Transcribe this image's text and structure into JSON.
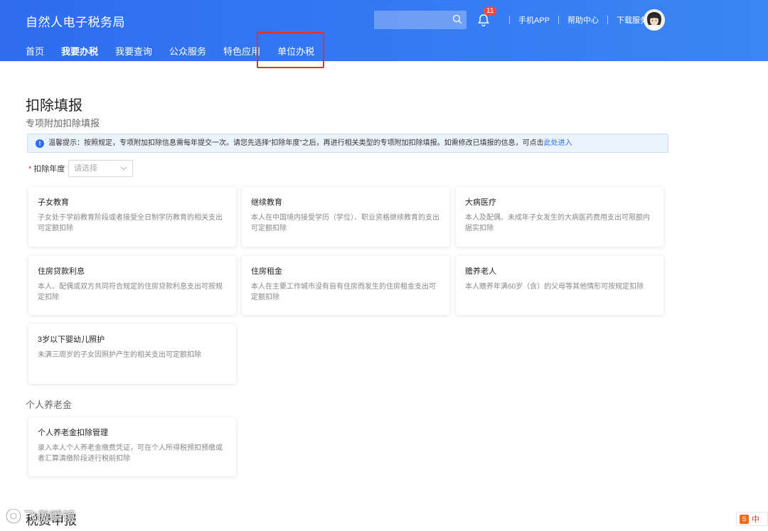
{
  "header": {
    "app_title": "自然人电子税务局",
    "search": {
      "value": "",
      "placeholder": ""
    },
    "notification_count": "11",
    "links": [
      "手机APP",
      "帮助中心",
      "下载服务"
    ]
  },
  "nav": {
    "items": [
      {
        "label": "首页",
        "active": false
      },
      {
        "label": "我要办税",
        "active": true
      },
      {
        "label": "我要查询",
        "active": false
      },
      {
        "label": "公众服务",
        "active": false
      },
      {
        "label": "特色应用",
        "active": false
      },
      {
        "label": "单位办税",
        "active": false
      }
    ]
  },
  "main": {
    "page_title": "扣除填报",
    "section_title": "专项附加扣除填报",
    "notice": {
      "text": "温馨提示：按照规定，专项附加扣除信息需每年提交一次。请您先选择“扣除年度”之后，再进行相关类型的专项附加扣除填报。如需修改已填报的信息，可点击",
      "link": "此处进入"
    },
    "year_field": {
      "label": "扣除年度",
      "placeholder": "请选择"
    },
    "cards": [
      {
        "title": "子女教育",
        "desc": "子女处于学前教育阶段或者接受全日制学历教育的相关支出可定额扣除"
      },
      {
        "title": "继续教育",
        "desc": "本人在中国境内接受学历（学位）、职业资格继续教育的支出可定额扣除"
      },
      {
        "title": "大病医疗",
        "desc": "本人及配偶、未成年子女发生的大病医药费用支出可限额内据实扣除"
      },
      {
        "title": "住房贷款利息",
        "desc": "本人、配偶或双方共同符合规定的住房贷款利息支出可按规定扣除"
      },
      {
        "title": "住房租金",
        "desc": "本人在主要工作城市没有自有住房而发生的住房租金支出可定额扣除"
      },
      {
        "title": "赡养老人",
        "desc": "本人赡养年满60岁（含）的父母等其他情形可按规定扣除"
      },
      {
        "title": "3岁以下婴幼儿照护",
        "desc": "未满三周岁的子女因照护产生的相关支出可定额扣除"
      }
    ],
    "pension": {
      "section_title": "个人养老金",
      "card": {
        "title": "个人养老金扣除管理",
        "desc": "录入本人个人养老金缴费凭证，可在个人所得税预扣预缴或者汇算清缴阶段进行税前扣除"
      }
    },
    "bottom_title": "税费申报"
  },
  "overlay": {
    "watermark": "飞傲瞬镜",
    "ime_label": "中"
  },
  "colors": {
    "header_blue": "#2f6cf0",
    "highlight_red": "#e0322f",
    "notice_bg": "#eaf3fe",
    "link_blue": "#2f6cf0"
  }
}
